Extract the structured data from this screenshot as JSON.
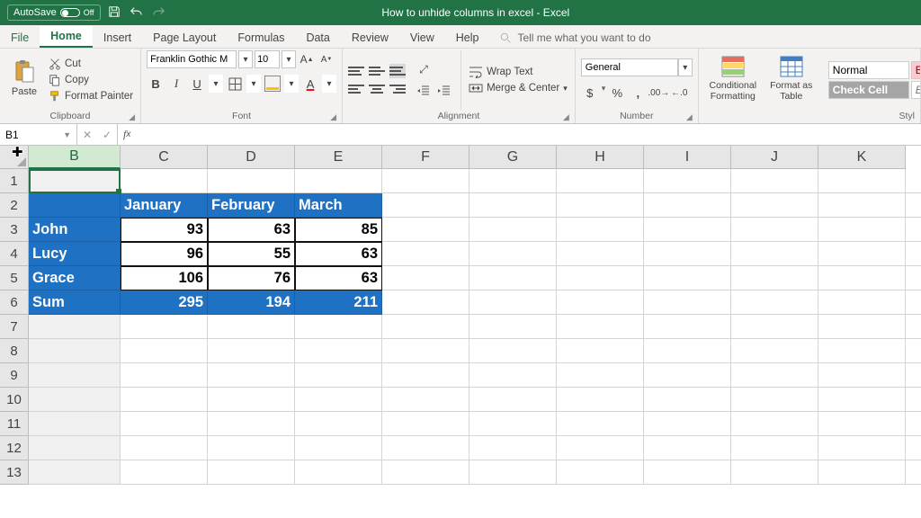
{
  "titlebar": {
    "autosave": "AutoSave",
    "autosave_state": "Off",
    "title": "How to unhide columns in excel  -  Excel"
  },
  "tabs": [
    "File",
    "Home",
    "Insert",
    "Page Layout",
    "Formulas",
    "Data",
    "Review",
    "View",
    "Help"
  ],
  "tell_me": "Tell me what you want to do",
  "clipboard": {
    "paste": "Paste",
    "cut": "Cut",
    "copy": "Copy",
    "format_painter": "Format Painter",
    "label": "Clipboard"
  },
  "font": {
    "family": "Franklin Gothic M",
    "size": "10",
    "label": "Font"
  },
  "alignment": {
    "wrap": "Wrap Text",
    "merge": "Merge & Center",
    "label": "Alignment"
  },
  "number": {
    "format": "General",
    "label": "Number"
  },
  "styles_big": {
    "cond": "Conditional Formatting",
    "fat": "Format as Table",
    "normal": "Normal",
    "bad": "Bad",
    "check": "Check Cell",
    "expl": "Explanatory …",
    "label": "Styl"
  },
  "namebox": "B1",
  "columns": [
    "B",
    "C",
    "D",
    "E",
    "F",
    "G",
    "H",
    "I",
    "J",
    "K"
  ],
  "rows": [
    "1",
    "2",
    "3",
    "4",
    "5",
    "6",
    "7",
    "8",
    "9",
    "10",
    "11",
    "12",
    "13"
  ],
  "data": {
    "headers": [
      "January",
      "February",
      "March"
    ],
    "row_labels": [
      "John",
      "Lucy",
      "Grace",
      "Sum"
    ],
    "values": [
      [
        "93",
        "63",
        "85"
      ],
      [
        "96",
        "55",
        "63"
      ],
      [
        "106",
        "76",
        "63"
      ],
      [
        "295",
        "194",
        "211"
      ]
    ]
  },
  "chart_data": {
    "type": "table",
    "columns": [
      "",
      "January",
      "February",
      "March"
    ],
    "rows": [
      [
        "John",
        93,
        63,
        85
      ],
      [
        "Lucy",
        96,
        55,
        63
      ],
      [
        "Grace",
        106,
        76,
        63
      ],
      [
        "Sum",
        295,
        194,
        211
      ]
    ]
  }
}
